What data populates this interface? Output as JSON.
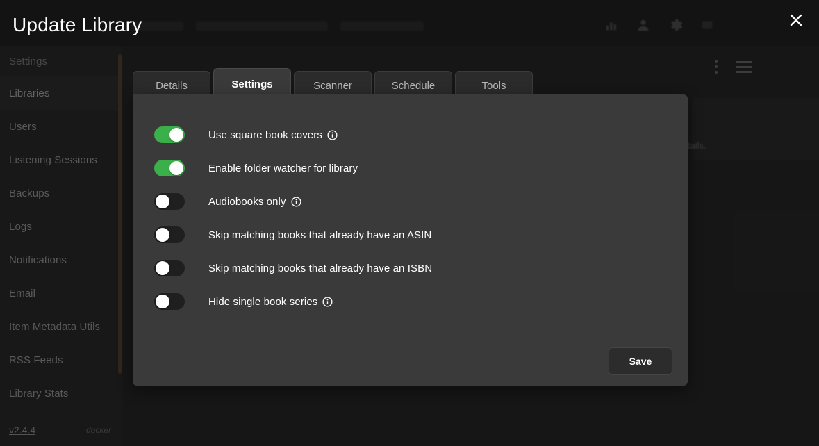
{
  "colors": {
    "page_bg": "#232323",
    "sidebar_bg": "#262626",
    "panel_bg": "#3a3a3a",
    "toggle_on": "#3baf4a",
    "toggle_off": "#1f1f1f",
    "scrollbar": "#5b4830",
    "accent_text": "#ffffff"
  },
  "modal": {
    "title": "Update Library",
    "close_label": "close-icon"
  },
  "sidebar": {
    "items": [
      {
        "label": "Settings",
        "state": "header"
      },
      {
        "label": "Libraries",
        "state": "selected"
      },
      {
        "label": "Users",
        "state": "normal"
      },
      {
        "label": "Listening Sessions",
        "state": "normal"
      },
      {
        "label": "Backups",
        "state": "normal"
      },
      {
        "label": "Logs",
        "state": "normal"
      },
      {
        "label": "Notifications",
        "state": "normal"
      },
      {
        "label": "Email",
        "state": "normal"
      },
      {
        "label": "Item Metadata Utils",
        "state": "normal"
      },
      {
        "label": "RSS Feeds",
        "state": "normal"
      },
      {
        "label": "Library Stats",
        "state": "normal"
      }
    ],
    "version": "v2.4.4",
    "deployment": "docker"
  },
  "tabs": [
    {
      "label": "Details",
      "active": false
    },
    {
      "label": "Settings",
      "active": true
    },
    {
      "label": "Scanner",
      "active": false
    },
    {
      "label": "Schedule",
      "active": false
    },
    {
      "label": "Tools",
      "active": false
    }
  ],
  "settings": {
    "toggles": [
      {
        "label": "Use square book covers",
        "on": true,
        "info": true
      },
      {
        "label": "Enable folder watcher for library",
        "on": true,
        "info": false
      },
      {
        "label": "Audiobooks only",
        "on": false,
        "info": true
      },
      {
        "label": "Skip matching books that already have an ASIN",
        "on": false,
        "info": false
      },
      {
        "label": "Skip matching books that already have an ISBN",
        "on": false,
        "info": false
      },
      {
        "label": "Hide single book series",
        "on": false,
        "info": true
      }
    ],
    "save_label": "Save"
  },
  "background": {
    "truncated_text": "rwrite details.",
    "icons": [
      "bar-chart-icon",
      "user-icon",
      "gear-icon",
      "kebab-menu-icon",
      "list-view-icon"
    ]
  }
}
